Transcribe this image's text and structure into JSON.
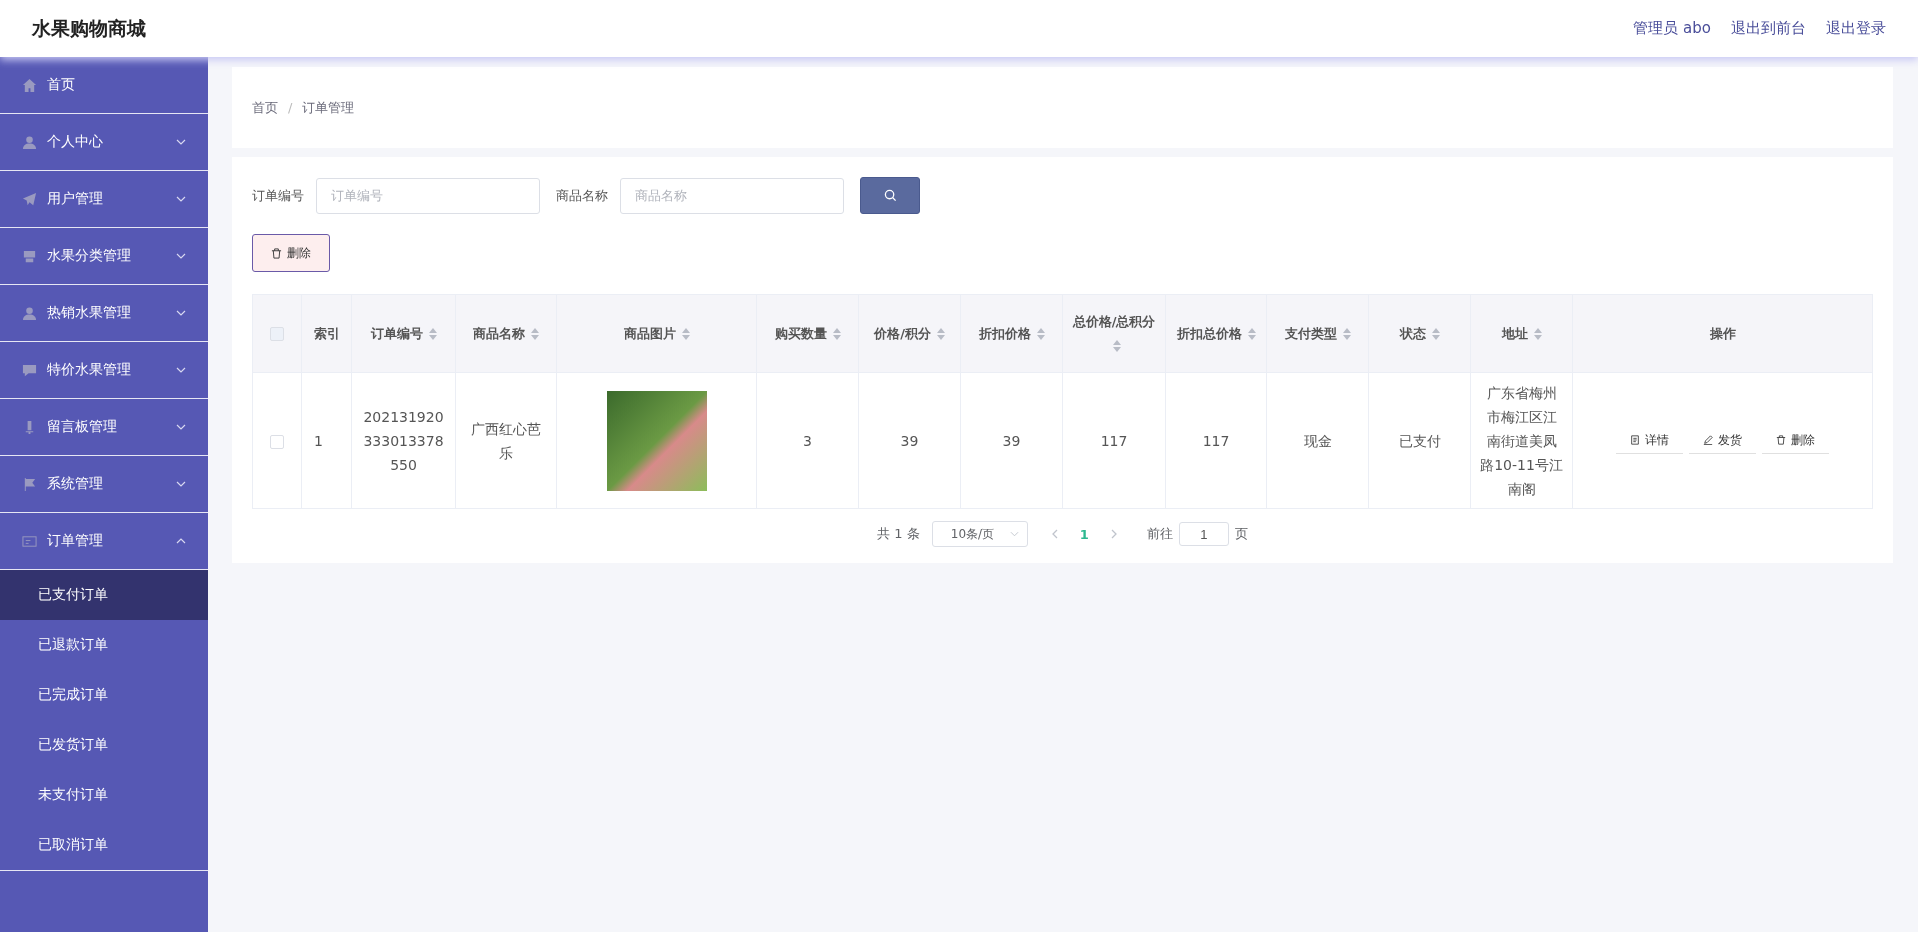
{
  "header": {
    "title": "水果购物商城",
    "links": [
      "管理员 abo",
      "退出到前台",
      "退出登录"
    ]
  },
  "sidebar": {
    "items": [
      {
        "label": "首页",
        "kind": "link"
      },
      {
        "label": "个人中心",
        "kind": "menu",
        "expanded": false
      },
      {
        "label": "用户管理",
        "kind": "menu",
        "expanded": false
      },
      {
        "label": "水果分类管理",
        "kind": "menu",
        "expanded": false
      },
      {
        "label": "热销水果管理",
        "kind": "menu",
        "expanded": false
      },
      {
        "label": "特价水果管理",
        "kind": "menu",
        "expanded": false
      },
      {
        "label": "留言板管理",
        "kind": "menu",
        "expanded": false
      },
      {
        "label": "系统管理",
        "kind": "menu",
        "expanded": false
      },
      {
        "label": "订单管理",
        "kind": "menu",
        "expanded": true,
        "children": [
          {
            "label": "已支付订单",
            "selected": true
          },
          {
            "label": "已退款订单",
            "selected": false
          },
          {
            "label": "已完成订单",
            "selected": false
          },
          {
            "label": "已发货订单",
            "selected": false
          },
          {
            "label": "未支付订单",
            "selected": false
          },
          {
            "label": "已取消订单",
            "selected": false
          }
        ]
      }
    ]
  },
  "breadcrumb": [
    "首页",
    "/",
    "订单管理"
  ],
  "search": {
    "fields": [
      {
        "label": "订单编号",
        "placeholder": "订单编号"
      },
      {
        "label": "商品名称",
        "placeholder": "商品名称"
      }
    ]
  },
  "delete_button": "删除",
  "table": {
    "select_all_checked": false,
    "columns": [
      {
        "label": "索引",
        "sortable": false
      },
      {
        "label": "订单编号",
        "sortable": true
      },
      {
        "label": "商品名称",
        "sortable": true
      },
      {
        "label": "商品图片",
        "sortable": true
      },
      {
        "label": "购买数量",
        "sortable": true
      },
      {
        "label": "价格/积分",
        "sortable": true
      },
      {
        "label": "折扣价格",
        "sortable": true
      },
      {
        "label": "总价格/总积分",
        "sortable": true
      },
      {
        "label": "折扣总价格",
        "sortable": true
      },
      {
        "label": "支付类型",
        "sortable": true
      },
      {
        "label": "状态",
        "sortable": true
      },
      {
        "label": "地址",
        "sortable": true
      },
      {
        "label": "操作",
        "sortable": false
      }
    ],
    "rows": [
      {
        "checked": false,
        "cells": [
          "1",
          "202131920333013378550",
          "广西红心芭乐",
          null,
          "3",
          "39",
          "39",
          "117",
          "117",
          "现金",
          "已支付",
          "广东省梅州市梅江区江南街道美凤路10-11号江南阁"
        ],
        "actions": [
          "详情",
          "发货",
          "删除"
        ]
      }
    ]
  },
  "pagination": {
    "total": "共 1 条",
    "page_size": "10条/页",
    "pages": [
      {
        "label": "1",
        "selected": true
      }
    ],
    "goto_label": "前往",
    "goto_value": "1",
    "goto_suffix": "页"
  }
}
